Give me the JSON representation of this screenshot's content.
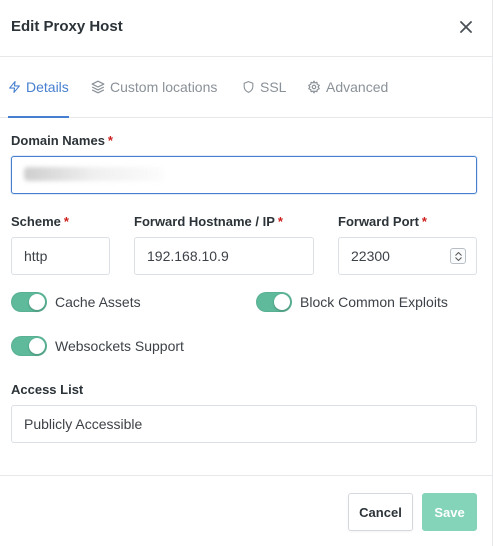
{
  "modal": {
    "title": "Edit Proxy Host"
  },
  "tabs": [
    {
      "label": "Details",
      "icon": "zap-icon",
      "active": true
    },
    {
      "label": "Custom locations",
      "icon": "layers-icon",
      "active": false
    },
    {
      "label": "SSL",
      "icon": "shield-icon",
      "active": false
    },
    {
      "label": "Advanced",
      "icon": "settings-icon",
      "active": false
    }
  ],
  "form": {
    "domain_names": {
      "label": "Domain Names",
      "required": "*"
    },
    "scheme": {
      "label": "Scheme",
      "required": "*",
      "value": "http"
    },
    "forward_hostname": {
      "label": "Forward Hostname / IP",
      "required": "*",
      "value": "192.168.10.9"
    },
    "forward_port": {
      "label": "Forward Port",
      "required": "*",
      "value": "22300"
    },
    "toggles": {
      "cache_assets": {
        "label": "Cache Assets",
        "on": true
      },
      "block_exploits": {
        "label": "Block Common Exploits",
        "on": true
      },
      "websockets": {
        "label": "Websockets Support",
        "on": true
      }
    },
    "access_list": {
      "label": "Access List",
      "value": "Publicly Accessible"
    }
  },
  "footer": {
    "cancel_label": "Cancel",
    "save_label": "Save"
  },
  "colors": {
    "accent": "#467fcf",
    "toggle_on": "#5eba9b",
    "save": "#83d4b8",
    "required": "#cd201f"
  }
}
